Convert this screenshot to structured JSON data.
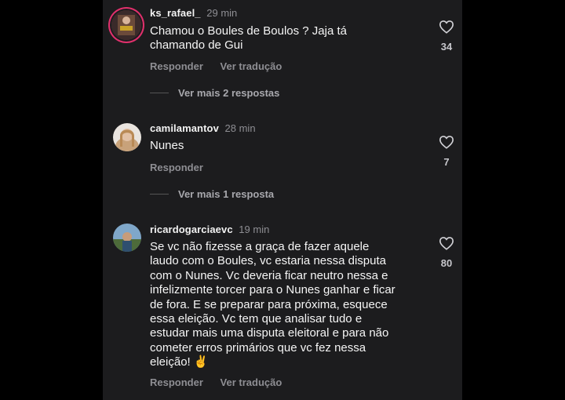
{
  "comments": [
    {
      "username": "ks_rafael_",
      "time": "29 min",
      "lines": [
        "Chamou o Boules de Boulos ? Jaja tá",
        "chamando de Gui"
      ],
      "reply_label": "Responder",
      "translate_label": "Ver tradução",
      "likes": "34",
      "replies_label": "Ver mais 2 respostas"
    },
    {
      "username": "camilamantov",
      "time": "28 min",
      "lines": [
        "Nunes"
      ],
      "reply_label": "Responder",
      "likes": "7",
      "replies_label": "Ver mais 1 resposta"
    },
    {
      "username": "ricardogarciaevc",
      "time": "19 min",
      "lines": [
        "Se vc não fizesse a graça de fazer aquele",
        "laudo com o Boules, vc estaria nessa disputa",
        "com o Nunes. Vc deveria ficar neutro nessa e",
        "infelizmente torcer para o Nunes ganhar e ficar",
        "de fora. E se preparar para próxima, esquece",
        "essa eleição. Vc tem que analisar tudo e",
        "estudar mais uma disputa eleitoral e para não",
        "cometer erros primários que vc fez nessa",
        "eleição! ✌️"
      ],
      "reply_label": "Responder",
      "translate_label": "Ver tradução",
      "likes": "80"
    }
  ],
  "colors": {
    "background": "#1c1c1e",
    "text": "#f5f5f5",
    "muted": "#8e8e93",
    "story_ring": "#e1306c"
  },
  "icons": {
    "like": "heart-outline-icon"
  }
}
